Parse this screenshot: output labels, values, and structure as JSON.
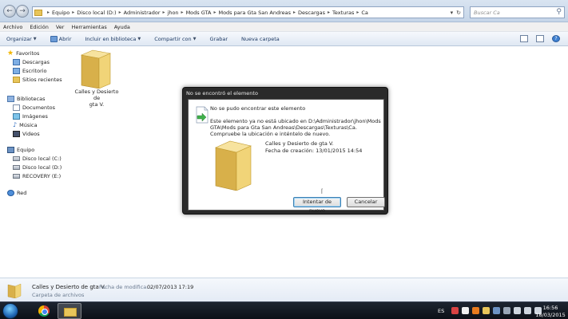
{
  "titlebar": {
    "breadcrumbs": [
      "Equipo",
      "Disco local (D:)",
      "Administrador",
      "jhon",
      "Mods GTA",
      "Mods para Gta San Andreas",
      "Descargas",
      "Texturas",
      "Ca"
    ],
    "search_placeholder": "Buscar Ca"
  },
  "menubar": [
    "Archivo",
    "Edición",
    "Ver",
    "Herramientas",
    "Ayuda"
  ],
  "toolbar": {
    "organize": "Organizar",
    "open": "Abrir",
    "include": "Incluir en biblioteca",
    "share": "Compartir con",
    "burn": "Grabar",
    "new_folder": "Nueva carpeta"
  },
  "navpane": {
    "favorites": "Favoritos",
    "fav_items": [
      "Descargas",
      "Escritorio",
      "Sitios recientes"
    ],
    "libraries": "Bibliotecas",
    "lib_items": [
      "Documentos",
      "Imágenes",
      "Música",
      "Videos"
    ],
    "computer": "Equipo",
    "drives": [
      "Disco local (C:)",
      "Disco local (D:)",
      "RECOVERY (E:)"
    ],
    "network": "Red"
  },
  "content": {
    "folder_name_line1": "Calles y Desierto de",
    "folder_name_line2": "gta V."
  },
  "details": {
    "name": "Calles y Desierto de gta V.",
    "modified_label": "Fecha de modifica...",
    "modified_value": "02/07/2013 17:19",
    "type": "Carpeta de archivos"
  },
  "dialog": {
    "title": "No se encontró el elemento",
    "heading": "No se pudo encontrar este elemento",
    "message": "Este elemento ya no está ubicado en D:\\Administrador\\jhon\\Mods GTA\\Mods para Gta San Andreas\\Descargas\\Texturas\\Ca. Compruebe la ubicación e inténtelo de nuevo.",
    "item_name": "Calles y Desierto de gta V.",
    "item_date": "Fecha de creación: 13/01/2015 14:54",
    "retry_label": "Intentar de nuevo",
    "cancel_label": "Cancelar"
  },
  "taskbar": {
    "language": "ES",
    "time": "16:56",
    "date": "18/03/2015"
  },
  "icons": {
    "folder_color": "#e8c55a",
    "accent": "#3c7fb1"
  }
}
